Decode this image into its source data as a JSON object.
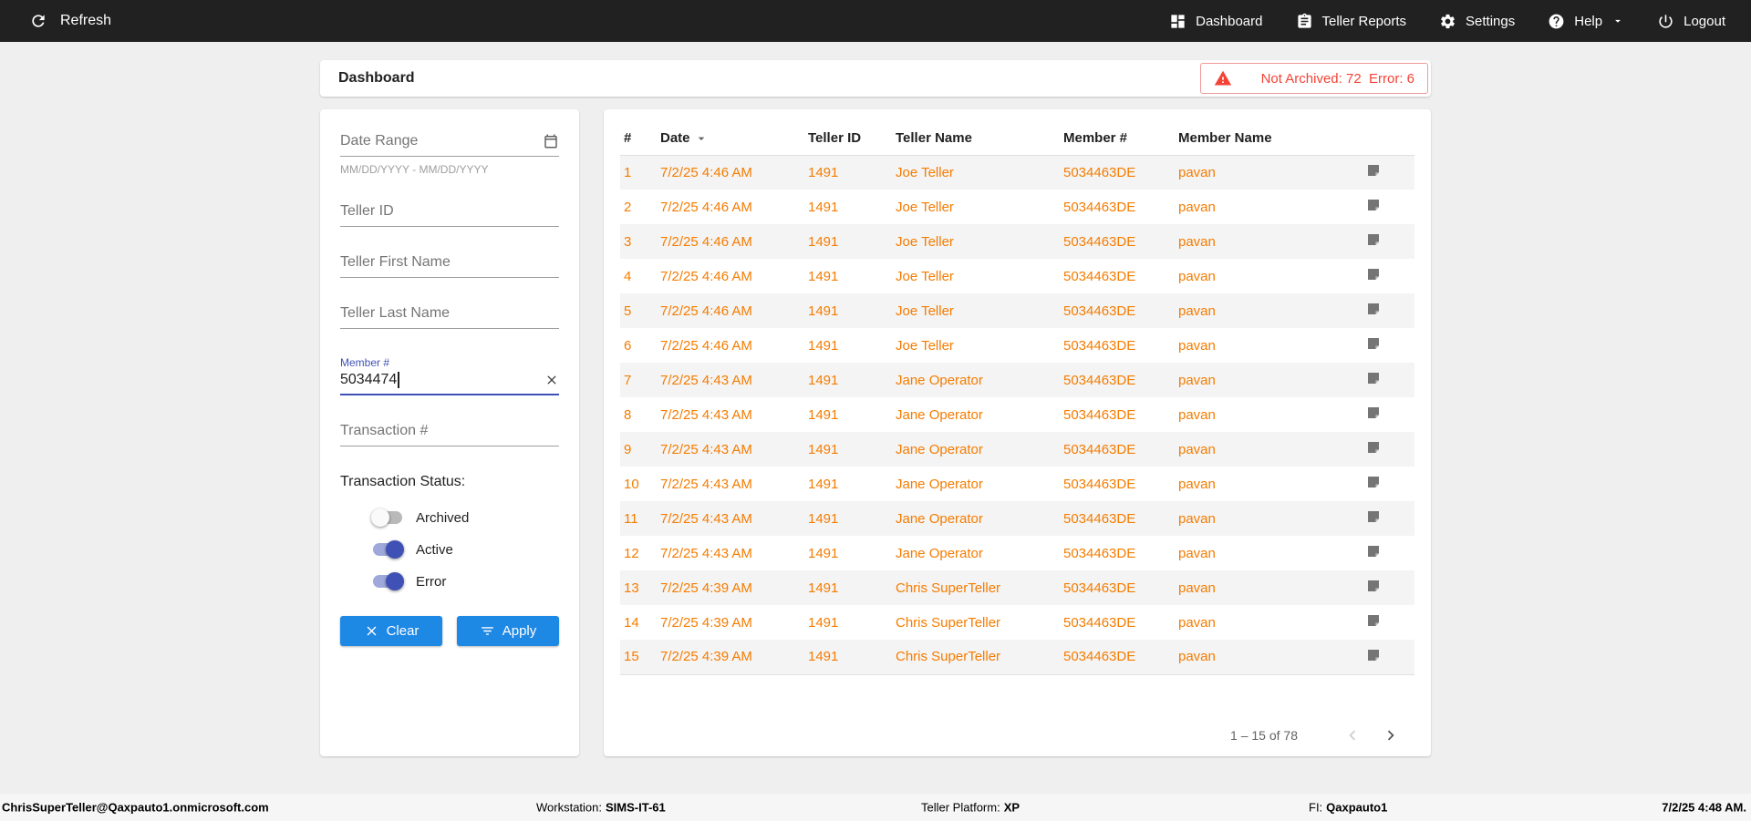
{
  "topbar": {
    "refresh_label": "Refresh",
    "nav": [
      {
        "label": "Dashboard"
      },
      {
        "label": "Teller Reports"
      },
      {
        "label": "Settings"
      },
      {
        "label": "Help"
      },
      {
        "label": "Logout"
      }
    ]
  },
  "header": {
    "title": "Dashboard",
    "alert_text": "Not Archived: 72  Error: 6"
  },
  "filters": {
    "date_range_placeholder": "Date Range",
    "date_range_hint": "MM/DD/YYYY - MM/DD/YYYY",
    "teller_id_placeholder": "Teller ID",
    "teller_first_name_placeholder": "Teller First Name",
    "teller_last_name_placeholder": "Teller Last Name",
    "member_label": "Member #",
    "member_value": "5034474",
    "transaction_placeholder": "Transaction #",
    "status_label": "Transaction Status:",
    "toggles": [
      {
        "label": "Archived",
        "on": false
      },
      {
        "label": "Active",
        "on": true
      },
      {
        "label": "Error",
        "on": true
      }
    ],
    "clear_label": "Clear",
    "apply_label": "Apply"
  },
  "table": {
    "columns": [
      "#",
      "Date",
      "Teller ID",
      "Teller Name",
      "Member #",
      "Member Name"
    ],
    "rows": [
      {
        "num": "1",
        "date": "7/2/25 4:46 AM",
        "teller_id": "1491",
        "teller_name": "Joe Teller",
        "member_num": "5034463DE",
        "member_name": "pavan"
      },
      {
        "num": "2",
        "date": "7/2/25 4:46 AM",
        "teller_id": "1491",
        "teller_name": "Joe Teller",
        "member_num": "5034463DE",
        "member_name": "pavan"
      },
      {
        "num": "3",
        "date": "7/2/25 4:46 AM",
        "teller_id": "1491",
        "teller_name": "Joe Teller",
        "member_num": "5034463DE",
        "member_name": "pavan"
      },
      {
        "num": "4",
        "date": "7/2/25 4:46 AM",
        "teller_id": "1491",
        "teller_name": "Joe Teller",
        "member_num": "5034463DE",
        "member_name": "pavan"
      },
      {
        "num": "5",
        "date": "7/2/25 4:46 AM",
        "teller_id": "1491",
        "teller_name": "Joe Teller",
        "member_num": "5034463DE",
        "member_name": "pavan"
      },
      {
        "num": "6",
        "date": "7/2/25 4:46 AM",
        "teller_id": "1491",
        "teller_name": "Joe Teller",
        "member_num": "5034463DE",
        "member_name": "pavan"
      },
      {
        "num": "7",
        "date": "7/2/25 4:43 AM",
        "teller_id": "1491",
        "teller_name": "Jane Operator",
        "member_num": "5034463DE",
        "member_name": "pavan"
      },
      {
        "num": "8",
        "date": "7/2/25 4:43 AM",
        "teller_id": "1491",
        "teller_name": "Jane Operator",
        "member_num": "5034463DE",
        "member_name": "pavan"
      },
      {
        "num": "9",
        "date": "7/2/25 4:43 AM",
        "teller_id": "1491",
        "teller_name": "Jane Operator",
        "member_num": "5034463DE",
        "member_name": "pavan"
      },
      {
        "num": "10",
        "date": "7/2/25 4:43 AM",
        "teller_id": "1491",
        "teller_name": "Jane Operator",
        "member_num": "5034463DE",
        "member_name": "pavan"
      },
      {
        "num": "11",
        "date": "7/2/25 4:43 AM",
        "teller_id": "1491",
        "teller_name": "Jane Operator",
        "member_num": "5034463DE",
        "member_name": "pavan"
      },
      {
        "num": "12",
        "date": "7/2/25 4:43 AM",
        "teller_id": "1491",
        "teller_name": "Jane Operator",
        "member_num": "5034463DE",
        "member_name": "pavan"
      },
      {
        "num": "13",
        "date": "7/2/25 4:39 AM",
        "teller_id": "1491",
        "teller_name": "Chris SuperTeller",
        "member_num": "5034463DE",
        "member_name": "pavan"
      },
      {
        "num": "14",
        "date": "7/2/25 4:39 AM",
        "teller_id": "1491",
        "teller_name": "Chris SuperTeller",
        "member_num": "5034463DE",
        "member_name": "pavan"
      },
      {
        "num": "15",
        "date": "7/2/25 4:39 AM",
        "teller_id": "1491",
        "teller_name": "Chris SuperTeller",
        "member_num": "5034463DE",
        "member_name": "pavan"
      }
    ],
    "paginator_range": "1 – 15 of 78"
  },
  "footer": {
    "user": "ChrisSuperTeller@Qaxpauto1.onmicrosoft.com",
    "workstation_label": "Workstation:",
    "workstation_value": "SIMS-IT-61",
    "platform_label": "Teller Platform:",
    "platform_value": "XP",
    "fi_label": "FI:",
    "fi_value": "Qaxpauto1",
    "datetime": "7/2/25 4:48 AM."
  },
  "colors": {
    "topbar_bg": "#212121",
    "accent_blue": "#1E88E5",
    "toggle_blue": "#3F51B5",
    "table_orange": "#F57C00",
    "alert_red": "#F44336"
  }
}
